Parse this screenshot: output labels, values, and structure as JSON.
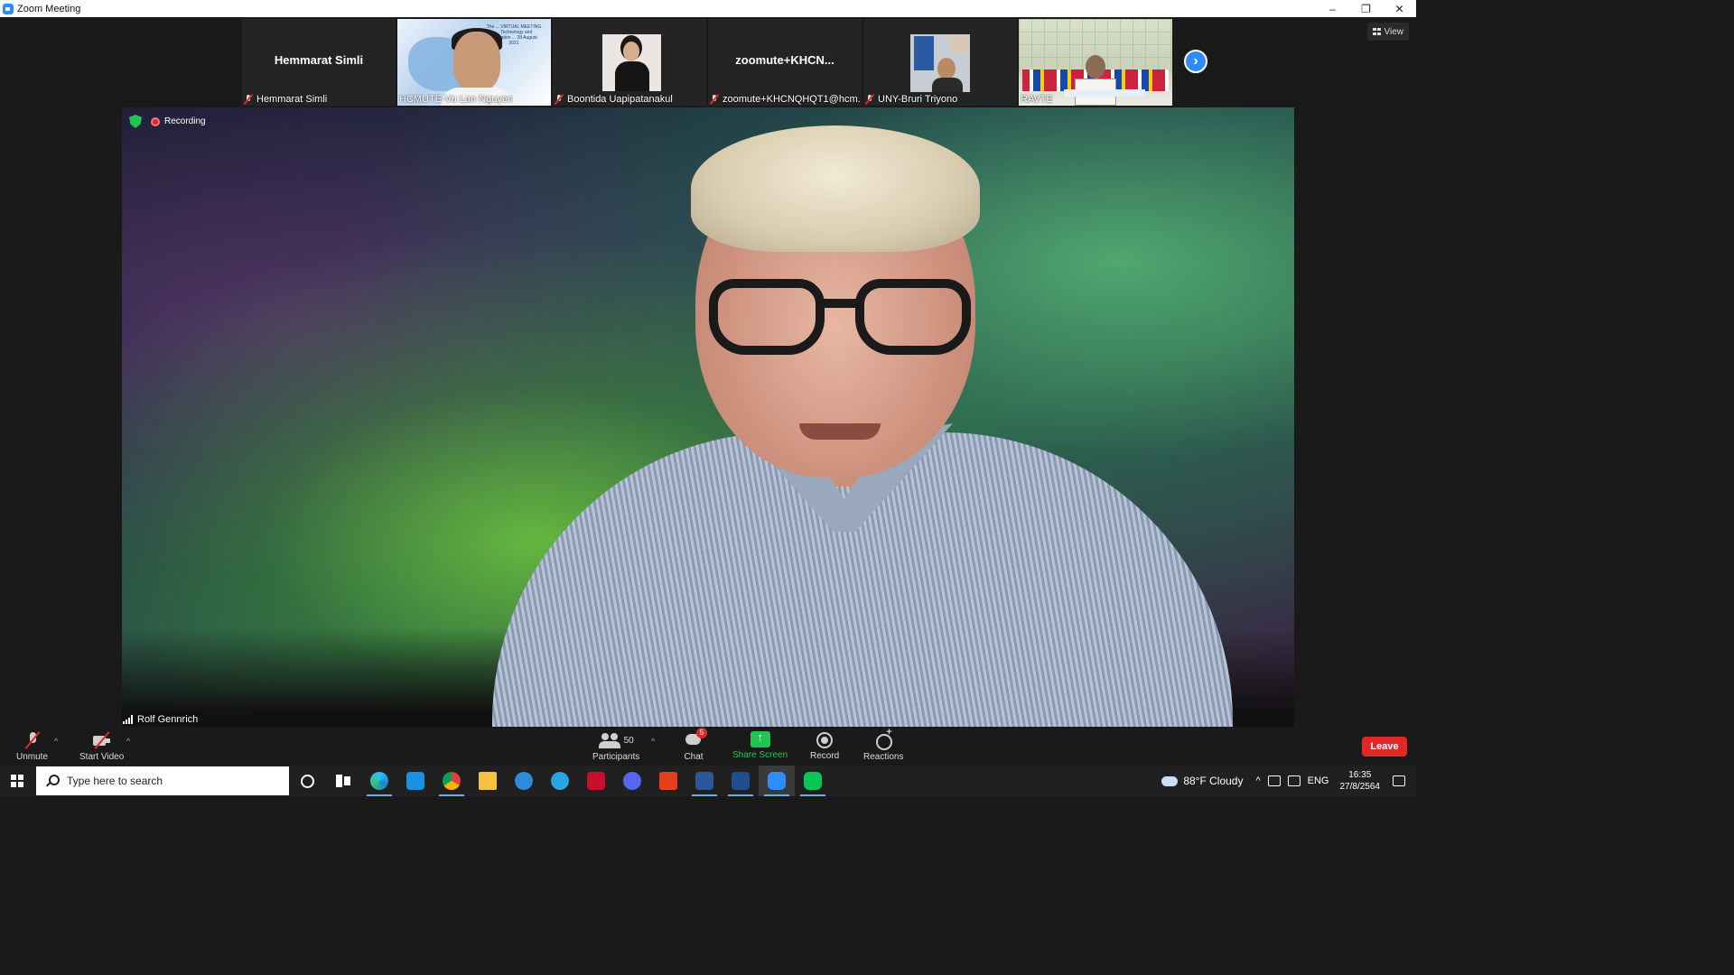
{
  "window": {
    "title": "Zoom Meeting",
    "controls": {
      "minimize": "–",
      "restore": "❐",
      "close": "✕"
    }
  },
  "view_button": {
    "label": "View"
  },
  "thumbnails": [
    {
      "big_name": "Hemmarat Simli",
      "label": "Hemmarat Simli",
      "muted": true
    },
    {
      "label": "HCMUTE-Vu Lan Nguyen",
      "muted": false,
      "banner": "The ... VIRTUAL MEETING ... Technology and Education ... 28 August 2021"
    },
    {
      "label": "Boontida Uapipatanakul",
      "muted": true
    },
    {
      "big_name": "zoomute+KHCN...",
      "label": "zoomute+KHCNQHQT1@hcm...",
      "muted": true
    },
    {
      "label": "UNY-Bruri Triyono",
      "muted": true
    },
    {
      "label": "RAVTE",
      "muted": false
    }
  ],
  "next_page_icon": "chevron-right-icon",
  "main_video": {
    "recording_label": "Recording",
    "speaker_name": "Rolf Gennrich"
  },
  "toolbar": {
    "unmute": "Unmute",
    "start_video": "Start Video",
    "participants": "Participants",
    "participants_count": "50",
    "chat": "Chat",
    "chat_badge": "5",
    "share_screen": "Share Screen",
    "record": "Record",
    "reactions": "Reactions",
    "leave": "Leave",
    "caret": "^"
  },
  "taskbar": {
    "search_placeholder": "Type here to search",
    "apps": [
      "cortana",
      "task-view",
      "edge",
      "mail",
      "chrome",
      "file-explorer",
      "app",
      "skype",
      "game",
      "discord",
      "office",
      "word",
      "word",
      "zoom",
      "line"
    ],
    "weather": "88°F  Cloudy",
    "language": "ENG",
    "time": "16:35",
    "date": "27/8/2564"
  },
  "colors": {
    "zoom_blue": "#2d8cff",
    "leave_red": "#e02828",
    "share_green": "#23c552",
    "meeting_bg": "#1a1a1a"
  }
}
